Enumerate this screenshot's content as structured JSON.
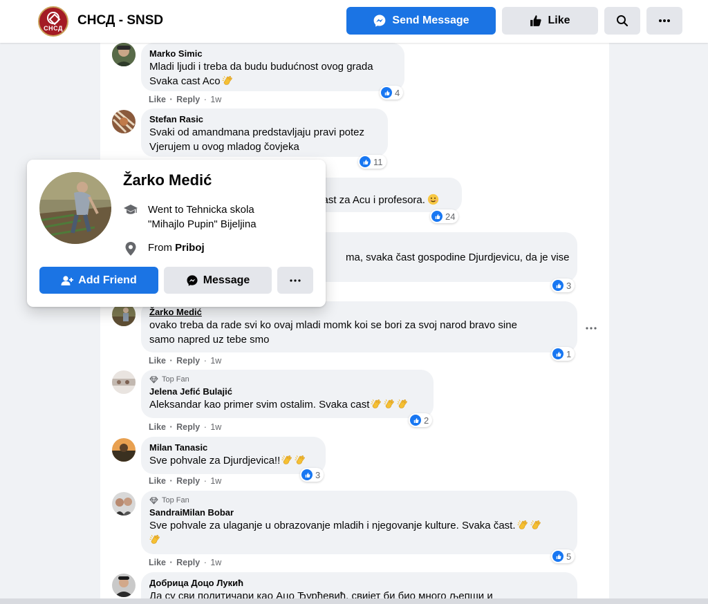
{
  "header": {
    "logo_text": "СНСД",
    "page_name": "СНСД - SNSD",
    "send_message_label": "Send Message",
    "like_label": "Like"
  },
  "colors": {
    "primary": "#1b74e4",
    "bubble": "#f0f2f5",
    "secondary_text": "#65676b"
  },
  "comment_actions": {
    "like": "Like",
    "reply": "Reply",
    "dot": "·"
  },
  "comments": [
    {
      "author": "Marko Simic",
      "lines": [
        "Mladi ljudi i treba da budu budućnost ovog grada",
        "Svaka cast Aco"
      ],
      "emoji": "clapping-hands",
      "reactions": "4",
      "time": "1w"
    },
    {
      "author": "Stefan Rasic",
      "lines": [
        "Svaki od amandmana predstavljaju pravi potez",
        "Vjerujem u ovog mladog čovjeka"
      ],
      "reactions": "11"
    },
    {
      "partial_text": "čast za Acu i profesora.",
      "emoji": "smiling-face",
      "reactions": "24"
    },
    {
      "partial_text": "ma, svaka čast gospodine Djurdjevicu, da je vise",
      "reactions": "3"
    },
    {
      "author": "Žarko Medić",
      "lines": [
        "ovako treba da rade svi ko ovaj mladi momk koi se bori za svoj narod bravo sine",
        "samo napred uz tebe smo"
      ],
      "reactions": "1",
      "time": "1w"
    },
    {
      "badge": "Top Fan",
      "author": "Jelena Jefić Bulajić",
      "lines": [
        "Aleksandar kao primer svim ostalim. Svaka cast"
      ],
      "emoji": "clapping-hands x3",
      "reactions": "2",
      "time": "1w"
    },
    {
      "author": "Milan Tanasic",
      "lines": [
        "Sve pohvale za Djurdjevica!!"
      ],
      "emoji": "clapping-hands x2",
      "reactions": "3",
      "time": "1w"
    },
    {
      "badge": "Top Fan",
      "author": "SandraiMilan Bobar",
      "lines": [
        "Sve pohvale za ulaganje u obrazovanje mladih i njegovanje kulture. Svaka čast."
      ],
      "emoji": "clapping-hands x3",
      "reactions": "5",
      "time": "1w"
    },
    {
      "author": "Добрица Доцо Лукић",
      "lines": [
        "Да су сви политичари као Ацо Ђурђевић, свијет би био много љепши и"
      ]
    }
  ],
  "hovercard": {
    "name": "Žarko Medić",
    "education_line1": "Went to Tehnicka skola",
    "education_line2": "\"Mihajlo Pupin\" Bijeljina",
    "from_prefix": "From",
    "from_place": "Priboj",
    "add_friend_label": "Add Friend",
    "message_label": "Message"
  }
}
